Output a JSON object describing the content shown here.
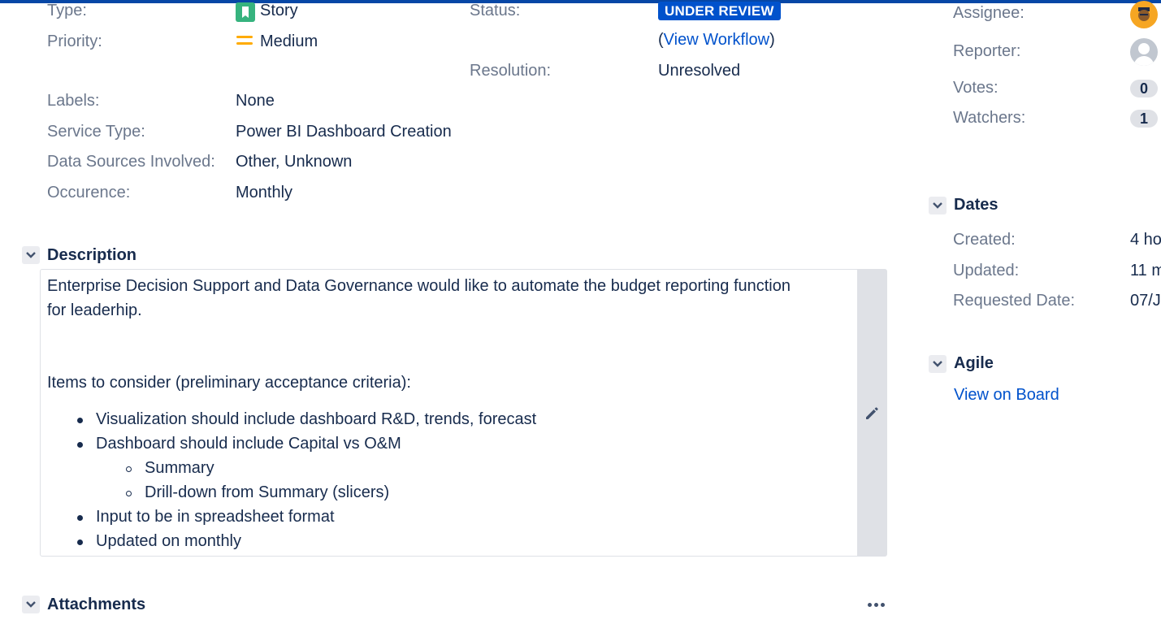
{
  "details": {
    "type_label": "Type:",
    "type_value": "Story",
    "priority_label": "Priority:",
    "priority_value": "Medium",
    "labels_label": "Labels:",
    "labels_value": "None",
    "service_type_label": "Service Type:",
    "service_type_value": "Power BI Dashboard Creation",
    "data_sources_label": "Data Sources Involved:",
    "data_sources_value": "Other, Unknown",
    "occurence_label": "Occurence:",
    "occurence_value": "Monthly",
    "status_label": "Status:",
    "status_value": "UNDER REVIEW",
    "workflow_open": "(",
    "workflow_link": "View Workflow",
    "workflow_close": ")",
    "resolution_label": "Resolution:",
    "resolution_value": "Unresolved"
  },
  "people": {
    "assignee_label": "Assignee:",
    "reporter_label": "Reporter:",
    "votes_label": "Votes:",
    "votes_count": "0",
    "watchers_label": "Watchers:",
    "watchers_count": "1"
  },
  "dates": {
    "title": "Dates",
    "created_label": "Created:",
    "created_value": "4 ho",
    "updated_label": "Updated:",
    "updated_value": "11 m",
    "requested_label": "Requested Date:",
    "requested_value": "07/J"
  },
  "agile": {
    "title": "Agile",
    "view_on_board": "View on Board"
  },
  "description": {
    "title": "Description",
    "line1": "Enterprise Decision Support and Data Governance would like to automate the budget reporting function",
    "line2": "for leaderhip.",
    "criteria_heading": "Items to consider (preliminary acceptance criteria):",
    "bullets": [
      "Visualization should include dashboard R&D, trends, forecast",
      "Dashboard should include Capital vs O&M",
      "Input to be in spreadsheet format",
      "Updated on monthly"
    ],
    "sub_bullets": [
      "Summary",
      "Drill-down from Summary (slicers)"
    ]
  },
  "attachments": {
    "title": "Attachments"
  },
  "colors": {
    "accent": "#0052cc",
    "story": "#36b37e",
    "priority_medium": "#ffab00",
    "header_bar": "#0747a6"
  },
  "icons": [
    "story-icon",
    "priority-medium-icon",
    "chevron-down-icon",
    "pencil-icon",
    "more-icon",
    "avatar"
  ]
}
